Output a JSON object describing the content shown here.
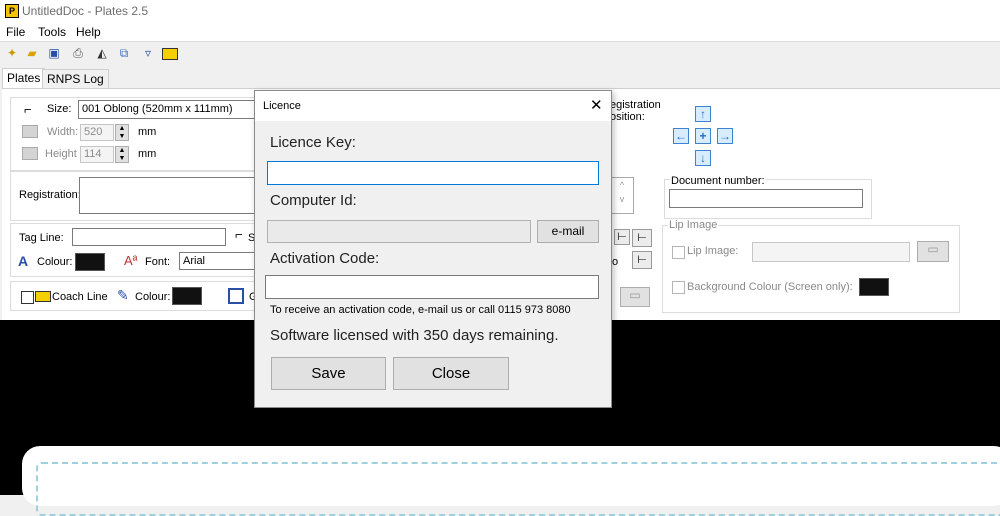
{
  "app": {
    "title": "UntitledDoc - Plates 2.5",
    "icon_letter": "P"
  },
  "menu": [
    "File",
    "Tools",
    "Help"
  ],
  "tabs": [
    "Plates",
    "RNPS Log"
  ],
  "size": {
    "label": "Size:",
    "value": "001 Oblong (520mm x 111mm)"
  },
  "width": {
    "label": "Width:",
    "value": "520",
    "unit": "mm"
  },
  "height": {
    "label": "Height",
    "value": "114",
    "unit": "mm"
  },
  "registration": {
    "label": "Registration:",
    "value": ""
  },
  "registration_position": {
    "label_line1": "egistration",
    "label_line2": "osition:"
  },
  "tagline": {
    "label": "Tag Line:",
    "value": "",
    "partial_label": "S",
    "colour_label": "Colour:",
    "font_label": "Font:",
    "font_value": "Arial",
    "partial_text": "o"
  },
  "coach": {
    "label": "Coach Line",
    "colour_label": "Colour:",
    "partial_label": "G"
  },
  "document_number": {
    "label": "Document number:",
    "value": ""
  },
  "lip": {
    "group_label": "Lip Image",
    "image_label": "Lip Image:",
    "background_label": "Background Colour (Screen only):"
  },
  "dialog": {
    "title": "Licence",
    "licence_key_label": "Licence Key:",
    "licence_key_value": "",
    "computer_id_label": "Computer Id:",
    "computer_id_value": "",
    "email_button": "e-mail",
    "activation_label": "Activation Code:",
    "activation_value": "",
    "info_text": "To receive an activation code, e-mail us or call 0115 973 8080",
    "status_text": "Software licensed with 350 days remaining.",
    "save_button": "Save",
    "close_button": "Close"
  },
  "colors": {
    "accent": "#3d83cf",
    "swatch": "#111111",
    "plate_border": "#9fd0de"
  }
}
